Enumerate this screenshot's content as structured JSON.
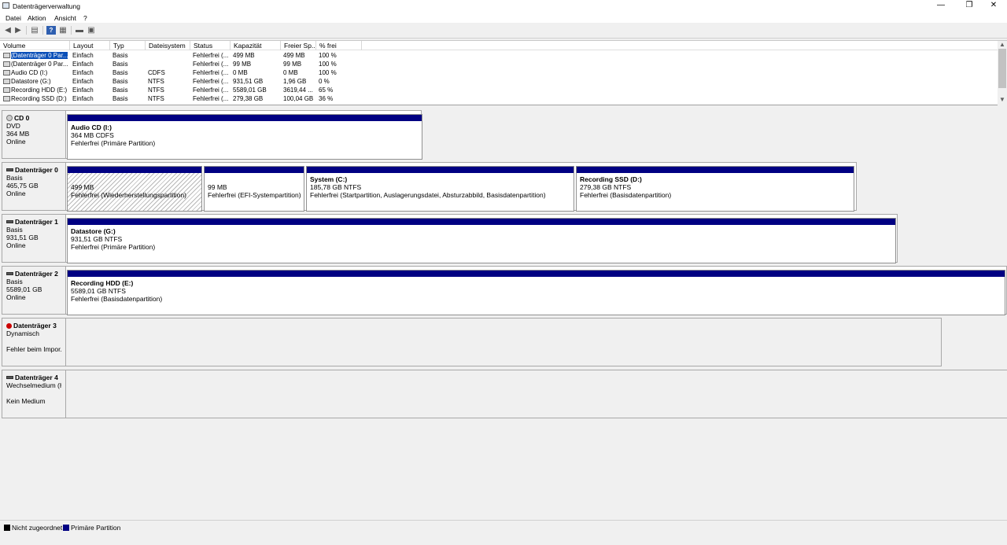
{
  "window": {
    "title": "Datenträgerverwaltung",
    "minimize": "—",
    "maximize": "❐",
    "close": "✕"
  },
  "menu": [
    "Datei",
    "Aktion",
    "Ansicht",
    "?"
  ],
  "toolbar": {
    "icons": [
      "back-arrow-icon",
      "forward-arrow-icon",
      "volume-list-icon",
      "help-icon",
      "properties-icon",
      "disk-view-icon",
      "settings-icon"
    ]
  },
  "columns": [
    "Volume",
    "Layout",
    "Typ",
    "Dateisystem",
    "Status",
    "Kapazität",
    "Freier Sp...",
    "% frei"
  ],
  "volumes": [
    {
      "name": "(Datenträger 0 Par...",
      "layout": "Einfach",
      "typ": "Basis",
      "fs": "",
      "status": "Fehlerfrei (...",
      "kap": "499 MB",
      "frei": "499 MB",
      "pct": "100 %"
    },
    {
      "name": "(Datenträger 0 Par...",
      "layout": "Einfach",
      "typ": "Basis",
      "fs": "",
      "status": "Fehlerfrei (...",
      "kap": "99 MB",
      "frei": "99 MB",
      "pct": "100 %"
    },
    {
      "name": "Audio CD (I:)",
      "layout": "Einfach",
      "typ": "Basis",
      "fs": "CDFS",
      "status": "Fehlerfrei (...",
      "kap": "0 MB",
      "frei": "0 MB",
      "pct": "100 %"
    },
    {
      "name": "Datastore (G:)",
      "layout": "Einfach",
      "typ": "Basis",
      "fs": "NTFS",
      "status": "Fehlerfrei (...",
      "kap": "931,51 GB",
      "frei": "1,96 GB",
      "pct": "0 %"
    },
    {
      "name": "Recording HDD (E:)",
      "layout": "Einfach",
      "typ": "Basis",
      "fs": "NTFS",
      "status": "Fehlerfrei (...",
      "kap": "5589,01 GB",
      "frei": "3619,44 ...",
      "pct": "65 %"
    },
    {
      "name": "Recording SSD (D:)",
      "layout": "Einfach",
      "typ": "Basis",
      "fs": "NTFS",
      "status": "Fehlerfrei (...",
      "kap": "279,38 GB",
      "frei": "100,04 GB",
      "pct": "36 %"
    }
  ],
  "disks": [
    {
      "name": "CD 0",
      "l1": "DVD",
      "l2": "364 MB",
      "l3": "Online",
      "parts": [
        {
          "name": "Audio CD  (I:)",
          "size": "364 MB CDFS",
          "status": "Fehlerfrei (Primäre Partition)"
        }
      ]
    },
    {
      "name": "Datenträger 0",
      "l1": "Basis",
      "l2": "465,75 GB",
      "l3": "Online",
      "parts": [
        {
          "name": "",
          "size": "499 MB",
          "status": "Fehlerfrei (Wiederherstellungspartition)"
        },
        {
          "name": "",
          "size": "99 MB",
          "status": "Fehlerfrei (EFI-Systempartition)"
        },
        {
          "name": "System  (C:)",
          "size": "185,78 GB NTFS",
          "status": "Fehlerfrei (Startpartition, Auslagerungsdatei, Absturzabbild, Basisdatenpartition)"
        },
        {
          "name": "Recording SSD  (D:)",
          "size": "279,38 GB NTFS",
          "status": "Fehlerfrei (Basisdatenpartition)"
        }
      ]
    },
    {
      "name": "Datenträger 1",
      "l1": "Basis",
      "l2": "931,51 GB",
      "l3": "Online",
      "parts": [
        {
          "name": "Datastore  (G:)",
          "size": "931,51 GB NTFS",
          "status": "Fehlerfrei (Primäre Partition)"
        }
      ]
    },
    {
      "name": "Datenträger 2",
      "l1": "Basis",
      "l2": "5589,01 GB",
      "l3": "Online",
      "parts": [
        {
          "name": "Recording HDD  (E:)",
          "size": "5589,01 GB NTFS",
          "status": "Fehlerfrei (Basisdatenpartition)"
        }
      ]
    },
    {
      "name": "Datenträger 3",
      "l1": "Dynamisch",
      "l2": "",
      "l3": "Fehler beim Impor..."
    },
    {
      "name": "Datenträger 4",
      "l1": "Wechselmedium (H",
      "l2": "",
      "l3": "Kein Medium"
    }
  ],
  "legend": {
    "unallocated": "Nicht zugeordnet",
    "primary": "Primäre Partition",
    "unallocated_color": "#000000",
    "primary_color": "#000082"
  }
}
